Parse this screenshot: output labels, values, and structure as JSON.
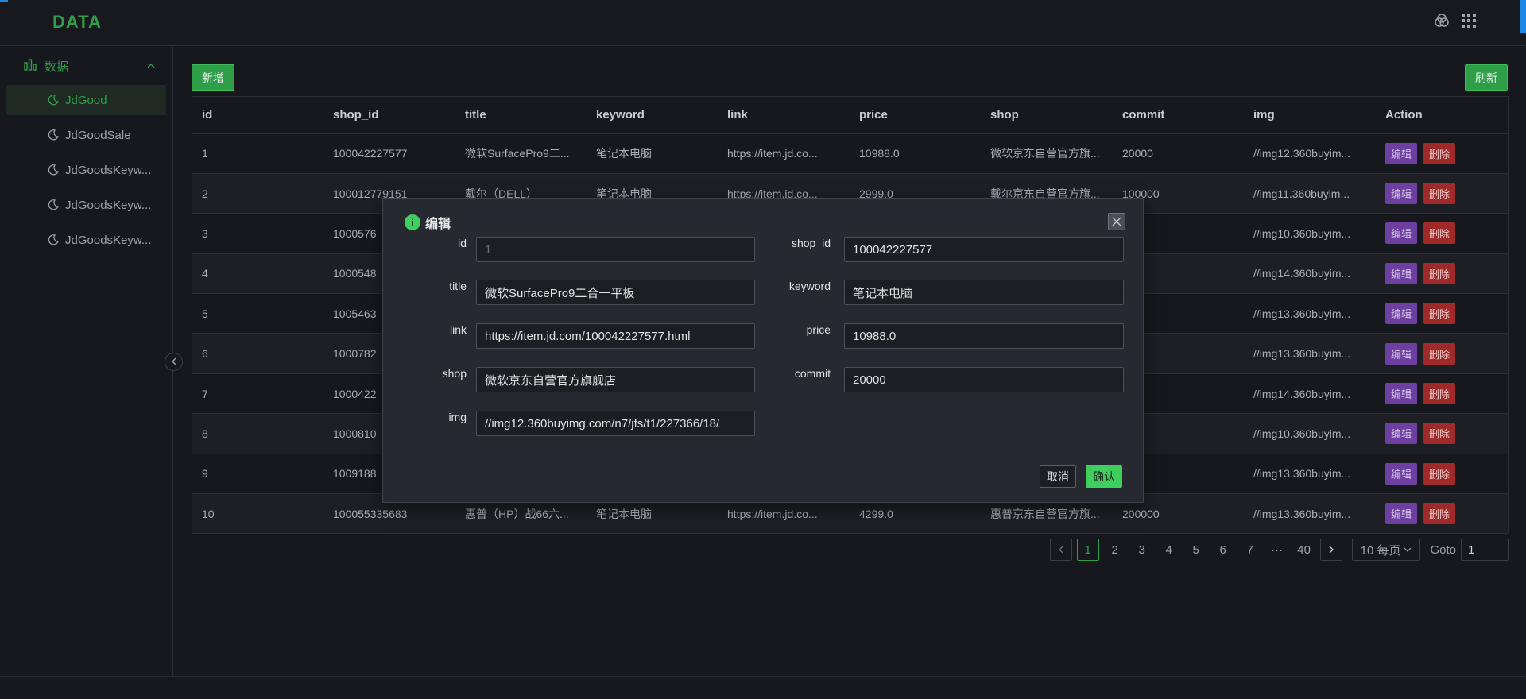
{
  "app": {
    "brand": "DATA"
  },
  "top_icons": [
    "circles-icon",
    "grid-apps-icon"
  ],
  "sidebar": {
    "group_label": "数据",
    "items": [
      {
        "label": "JdGood",
        "active": true
      },
      {
        "label": "JdGoodSale",
        "active": false
      },
      {
        "label": "JdGoodsKeyw...",
        "active": false
      },
      {
        "label": "JdGoodsKeyw...",
        "active": false
      },
      {
        "label": "JdGoodsKeyw...",
        "active": false
      }
    ]
  },
  "toolbar": {
    "add_label": "新增",
    "refresh_label": "刷新"
  },
  "table": {
    "columns": [
      "id",
      "shop_id",
      "title",
      "keyword",
      "link",
      "price",
      "shop",
      "commit",
      "img",
      "Action"
    ],
    "edit_label": "编辑",
    "delete_label": "删除",
    "rows": [
      [
        "1",
        "100042227577",
        "微软SurfacePro9二...",
        "笔记本电脑",
        "https://item.jd.co...",
        "10988.0",
        "微软京东自营官方旗...",
        "20000",
        "//img12.360buyim..."
      ],
      [
        "2",
        "100012779151",
        "戴尔（DELL）",
        "笔记本电脑",
        "https://item.jd.co...",
        "2999.0",
        "戴尔京东自营官方旗...",
        "100000",
        "//img11.360buyim..."
      ],
      [
        "3",
        "1000576",
        "",
        "",
        "",
        "",
        "",
        "000",
        "//img10.360buyim..."
      ],
      [
        "4",
        "1000548",
        "",
        "",
        "",
        "",
        "",
        "000",
        "//img14.360buyim..."
      ],
      [
        "5",
        "1005463",
        "",
        "",
        "",
        "",
        "",
        "00",
        "//img13.360buyim..."
      ],
      [
        "6",
        "1000782",
        "",
        "",
        "",
        "",
        "",
        "00",
        "//img13.360buyim..."
      ],
      [
        "7",
        "1000422",
        "",
        "",
        "",
        "",
        "",
        "00",
        "//img14.360buyim..."
      ],
      [
        "8",
        "1000810",
        "",
        "",
        "",
        "",
        "",
        "",
        "//img10.360buyim..."
      ],
      [
        "9",
        "1009188",
        "",
        "",
        "",
        "",
        "",
        "",
        "//img13.360buyim..."
      ],
      [
        "10",
        "100055335683",
        "惠普（HP）战66六...",
        "笔记本电脑",
        "https://item.jd.co...",
        "4299.0",
        "惠普京东自营官方旗...",
        "200000",
        "//img13.360buyim..."
      ]
    ]
  },
  "pagination": {
    "pages": [
      "1",
      "2",
      "3",
      "4",
      "5",
      "6",
      "7",
      "···",
      "40"
    ],
    "current": "1",
    "page_size": "10 每页",
    "goto_label": "Goto",
    "goto_value": "1"
  },
  "modal": {
    "title": "编辑",
    "fields": {
      "id": {
        "label": "id",
        "value": "1"
      },
      "shop_id": {
        "label": "shop_id",
        "value": "100042227577"
      },
      "title": {
        "label": "title",
        "value": "微软SurfacePro9二合一平板"
      },
      "keyword": {
        "label": "keyword",
        "value": "笔记本电脑"
      },
      "link": {
        "label": "link",
        "value": "https://item.jd.com/100042227577.html"
      },
      "price": {
        "label": "price",
        "value": "10988.0"
      },
      "shop": {
        "label": "shop",
        "value": "微软京东自营官方旗舰店"
      },
      "commit": {
        "label": "commit",
        "value": "20000"
      },
      "img": {
        "label": "img",
        "value": "//img12.360buyimg.com/n7/jfs/t1/227366/18/"
      }
    },
    "cancel_label": "取消",
    "ok_label": "确认"
  },
  "colors": {
    "accent": "#2e9f48",
    "edit": "#6d3fa0",
    "delete": "#a02a2a",
    "ok": "#3ecf5e"
  }
}
